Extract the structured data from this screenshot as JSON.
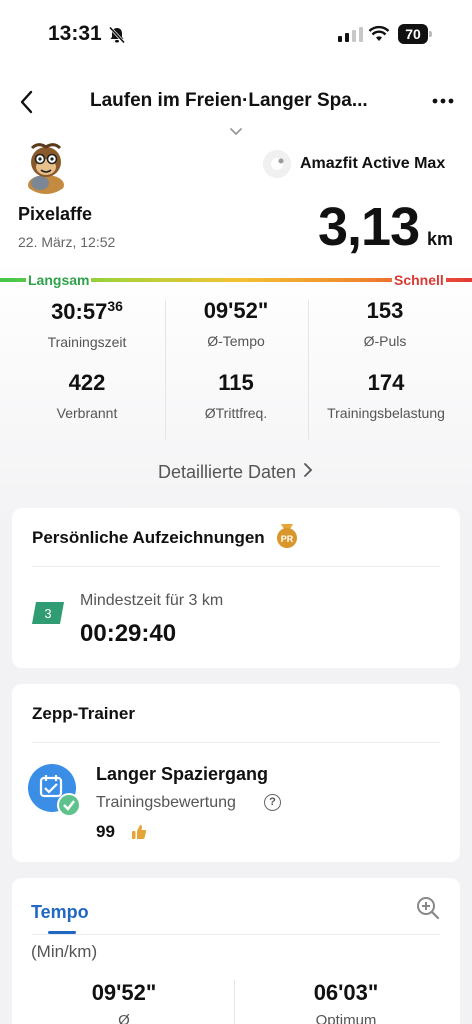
{
  "status_bar": {
    "time": "13:31",
    "battery": "70"
  },
  "header": {
    "title": "Laufen im Freien·Langer Spa..."
  },
  "device": {
    "name": "Amazfit Active Max"
  },
  "user": {
    "name": "Pixelaffe",
    "date": "22. März, 12:52"
  },
  "distance": {
    "value": "3,13",
    "unit": "km"
  },
  "speed_scale": {
    "slow": "Langsam",
    "fast": "Schnell"
  },
  "stats": [
    {
      "value": "30:57",
      "sup": "36",
      "label": "Trainingszeit"
    },
    {
      "value": "09'52\"",
      "label": "Ø-Tempo"
    },
    {
      "value": "153",
      "label": "Ø-Puls"
    },
    {
      "value": "422",
      "label": "Verbrannt"
    },
    {
      "value": "115",
      "label": "ØTrittfreq."
    },
    {
      "value": "174",
      "label": "Trainingsbelastung"
    }
  ],
  "detail_link": "Detaillierte Daten",
  "records": {
    "title": "Persönliche Aufzeichnungen",
    "badge": "PR",
    "km_badge": "3",
    "label": "Mindestzeit für 3 km",
    "value": "00:29:40"
  },
  "trainer": {
    "title": "Zepp-Trainer",
    "name": "Langer Spaziergang",
    "sub": "Trainingsbewertung",
    "score": "99"
  },
  "tempo_card": {
    "tab": "Tempo",
    "unit": "(Min/km)",
    "avg_value": "09'52\"",
    "avg_label": "Ø",
    "best_value": "06'03\"",
    "best_label": "Optimum"
  },
  "colors": {
    "accent": "#2167c4",
    "slow": "#2fa24a",
    "fast": "#d83a33"
  }
}
